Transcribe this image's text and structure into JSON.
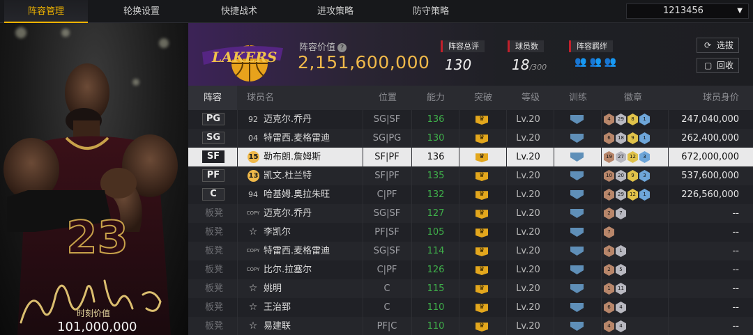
{
  "nav": {
    "tabs": [
      "阵容管理",
      "轮换设置",
      "快捷战术",
      "进攻策略",
      "防守策略"
    ],
    "active_index": 0,
    "account_id": "1213456"
  },
  "player_card": {
    "team_value_label": "时刻价值",
    "team_value": "101,000,000",
    "jersey": "23"
  },
  "header": {
    "lineup_value_label": "阵容价值",
    "lineup_value": "2,151,600,000",
    "total_rating_label": "阵容总评",
    "total_rating": "130",
    "player_count_label": "球员数",
    "player_count": "18",
    "player_count_max": "/300",
    "chemistry_label": "阵容羁绊",
    "select_button": "选拔",
    "recycle_button": "回收",
    "colors": {
      "accent": "#f0b94a",
      "brand_purple": "#552583"
    }
  },
  "table": {
    "headers": [
      "阵容",
      "球员名",
      "位置",
      "能力",
      "突破",
      "等级",
      "训练",
      "徽章",
      "球员身价"
    ],
    "bench_label": "板凳",
    "rows": [
      {
        "slot": "PG",
        "num": "92",
        "name": "迈克尔.乔丹",
        "pos": "SG|SF",
        "ability": "136",
        "level": "Lv.20",
        "badges": [
          [
            "b",
            "4"
          ],
          [
            "s",
            "29"
          ],
          [
            "g",
            "8"
          ],
          [
            "h",
            "1"
          ]
        ],
        "salary": "247,040,000"
      },
      {
        "slot": "SG",
        "num": "04",
        "name": "特雷西.麦格雷迪",
        "pos": "SG|PG",
        "ability": "130",
        "level": "Lv.20",
        "badges": [
          [
            "b",
            "6"
          ],
          [
            "s",
            "18"
          ],
          [
            "g",
            "9"
          ],
          [
            "h",
            "1"
          ]
        ],
        "salary": "262,400,000"
      },
      {
        "slot": "SF",
        "num": "15",
        "name": "勒布朗.詹姆斯",
        "pos": "SF|PF",
        "ability": "136",
        "level": "Lv.20",
        "badges": [
          [
            "b",
            "19"
          ],
          [
            "s",
            "27"
          ],
          [
            "g",
            "12"
          ],
          [
            "h",
            "3"
          ]
        ],
        "salary": "672,000,000"
      },
      {
        "slot": "PF",
        "num": "13",
        "name": "凯文.杜兰特",
        "pos": "SF|PF",
        "ability": "135",
        "level": "Lv.20",
        "badges": [
          [
            "b",
            "10"
          ],
          [
            "s",
            "20"
          ],
          [
            "g",
            "9"
          ],
          [
            "h",
            "3"
          ]
        ],
        "salary": "537,600,000"
      },
      {
        "slot": "C",
        "num": "94",
        "name": "哈基姆.奥拉朱旺",
        "pos": "C|PF",
        "ability": "132",
        "level": "Lv.20",
        "badges": [
          [
            "b",
            "4"
          ],
          [
            "s",
            "29"
          ],
          [
            "g",
            "12"
          ],
          [
            "h",
            "1"
          ]
        ],
        "salary": "226,560,000"
      },
      {
        "slot": "",
        "num": "COPY",
        "name": "迈克尔.乔丹",
        "pos": "SG|SF",
        "ability": "127",
        "level": "Lv.20",
        "badges": [
          [
            "b",
            "2"
          ],
          [
            "s",
            "7"
          ]
        ],
        "salary": "--"
      },
      {
        "slot": "",
        "num": "☆",
        "name": "李凯尔",
        "pos": "PF|SF",
        "ability": "105",
        "level": "Lv.20",
        "badges": [
          [
            "b",
            "7"
          ]
        ],
        "salary": "--"
      },
      {
        "slot": "",
        "num": "COPY",
        "name": "特雷西.麦格雷迪",
        "pos": "SG|SF",
        "ability": "114",
        "level": "Lv.20",
        "badges": [
          [
            "b",
            "4"
          ],
          [
            "s",
            "1"
          ]
        ],
        "salary": "--"
      },
      {
        "slot": "",
        "num": "COPY",
        "name": "比尔.拉塞尔",
        "pos": "C|PF",
        "ability": "126",
        "level": "Lv.20",
        "badges": [
          [
            "b",
            "2"
          ],
          [
            "s",
            "5"
          ]
        ],
        "salary": "--"
      },
      {
        "slot": "",
        "num": "☆",
        "name": "姚明",
        "pos": "C",
        "ability": "115",
        "level": "Lv.20",
        "badges": [
          [
            "b",
            "1"
          ],
          [
            "s",
            "11"
          ]
        ],
        "salary": "--"
      },
      {
        "slot": "",
        "num": "☆",
        "name": "王治郅",
        "pos": "C",
        "ability": "110",
        "level": "Lv.20",
        "badges": [
          [
            "b",
            "6"
          ],
          [
            "s",
            "4"
          ]
        ],
        "salary": "--"
      },
      {
        "slot": "",
        "num": "☆",
        "name": "易建联",
        "pos": "PF|C",
        "ability": "110",
        "level": "Lv.20",
        "badges": [
          [
            "b",
            "4"
          ],
          [
            "s",
            "4"
          ]
        ],
        "salary": "--"
      }
    ]
  }
}
